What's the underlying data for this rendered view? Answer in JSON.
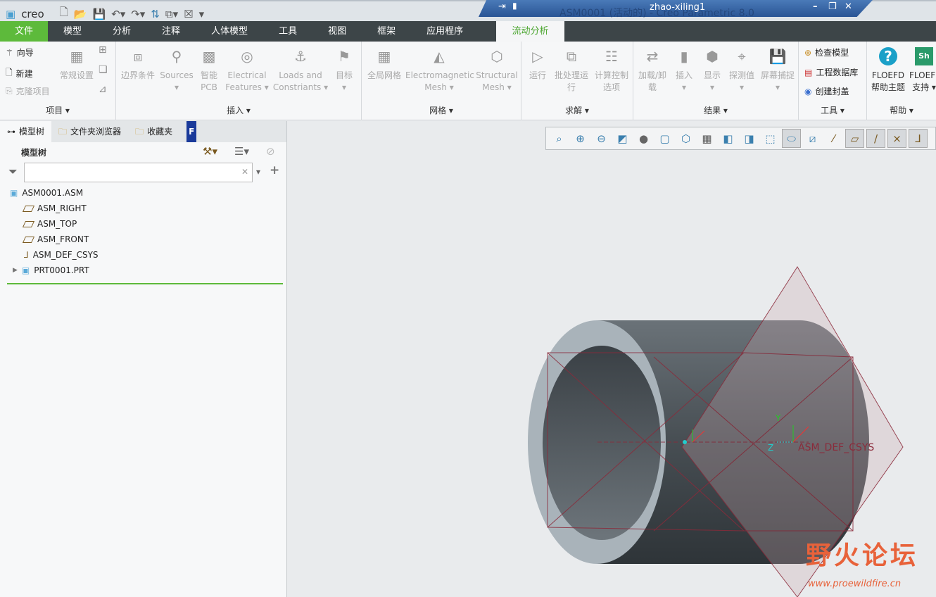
{
  "app": {
    "logo": "creo",
    "window_title": "ASM0001 (活动的) - Creo Parametric 8.0",
    "user": "zhao-xiling1"
  },
  "menu": {
    "tabs": [
      "文件",
      "模型",
      "分析",
      "注释",
      "人体模型",
      "工具",
      "视图",
      "框架",
      "应用程序",
      "流动分析"
    ],
    "active": "流动分析"
  },
  "ribbon": {
    "project": {
      "label": "项目",
      "items": [
        "向导",
        "新建",
        "克隆项目",
        "常规设置"
      ]
    },
    "insert": {
      "label": "插入",
      "items": [
        "边界条件",
        "Sources",
        "智能\nPCB",
        "Electrical\nFeatures",
        "Loads and\nConstriants",
        "目标"
      ]
    },
    "mesh": {
      "label": "网格",
      "items": [
        "全局网格",
        "Electromagnetic\nMesh",
        "Structural\nMesh"
      ]
    },
    "solve": {
      "label": "求解",
      "items": [
        "运行",
        "批处理运\n行",
        "计算控制\n选项"
      ]
    },
    "results": {
      "label": "结果",
      "items": [
        "加载/卸\n载",
        "插入",
        "显示",
        "探测值",
        "屏幕捕捉"
      ]
    },
    "tools": {
      "label": "工具",
      "items": [
        "检查模型",
        "工程数据库",
        "创建封盖"
      ]
    },
    "help": {
      "label": "帮助",
      "items": [
        "FLOEFD\n帮助主题",
        "FLOEFD\n支持"
      ]
    }
  },
  "panel": {
    "tabs": [
      "模型树",
      "文件夹浏览器",
      "收藏夹"
    ],
    "title": "模型树",
    "search_value": "",
    "tree": [
      "ASM0001.ASM",
      "ASM_RIGHT",
      "ASM_TOP",
      "ASM_FRONT",
      "ASM_DEF_CSYS",
      "PRT0001.PRT"
    ]
  },
  "viewport": {
    "csys_label": "ASM_DEF_CSYS",
    "axis_labels": [
      "Y",
      "Z"
    ]
  },
  "watermark": {
    "text": "野火论坛",
    "url": "www.proewildfire.cn"
  },
  "colors": {
    "accent": "#5dba3b",
    "menubar": "#3d4548",
    "datum": "#8b2a3a"
  }
}
